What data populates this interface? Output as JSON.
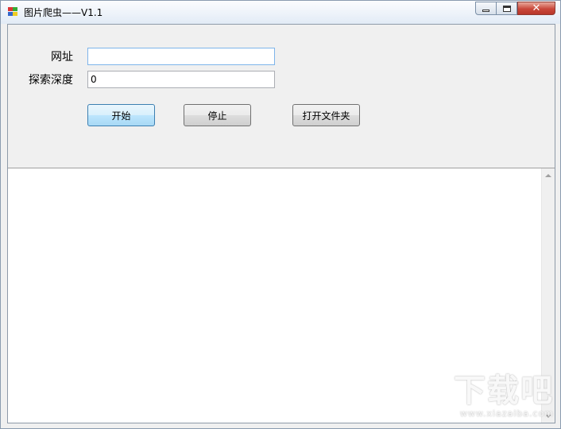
{
  "window": {
    "title": "图片爬虫——V1.1",
    "close_glyph": "✕"
  },
  "form": {
    "url_label": "网址",
    "url_value": "",
    "depth_label": "探索深度",
    "depth_value": "0"
  },
  "buttons": {
    "start": "开始",
    "stop": "停止",
    "open_folder": "打开文件夹"
  },
  "log": {
    "content": ""
  },
  "watermark": {
    "text": "下载吧",
    "url": "www.xiazaiba.com"
  },
  "colors": {
    "close_button": "#c9473a",
    "focus_border": "#7eb4ea",
    "default_button_border": "#3c7fb1"
  }
}
